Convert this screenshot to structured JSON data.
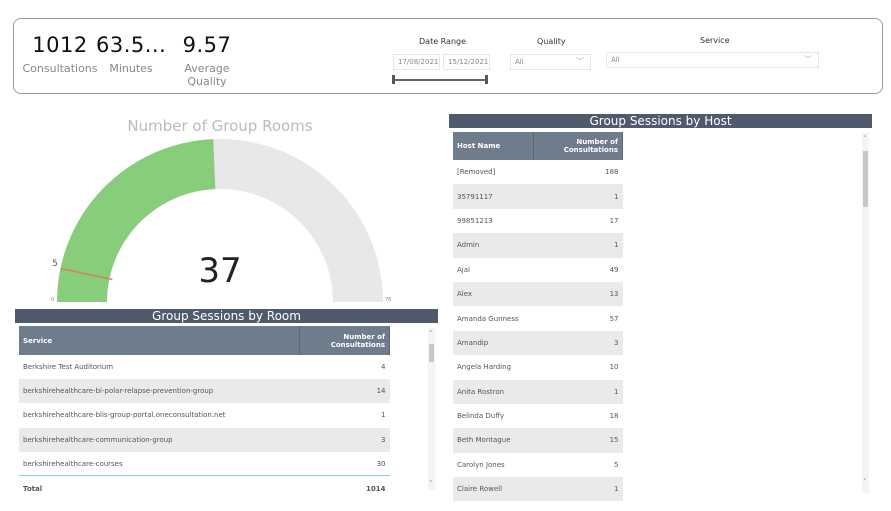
{
  "kpis": [
    {
      "value": "1012",
      "label": "Consultations"
    },
    {
      "value": "63.5...",
      "label": "Minutes"
    },
    {
      "value": "9.57",
      "label": "Average Quality"
    }
  ],
  "filters": {
    "date_range": {
      "label": "Date Range",
      "start": "17/08/2021",
      "end": "15/12/2021"
    },
    "quality": {
      "label": "Quality",
      "value": "All"
    },
    "service": {
      "label": "Service",
      "value": "All"
    }
  },
  "gauge": {
    "title": "Number of Group Rooms",
    "value": 37,
    "value_label": "37",
    "min": 0,
    "min_label": "0",
    "max": 76,
    "max_label": "76",
    "target": 5,
    "target_label": "5",
    "fill_color": "#87cd7c",
    "track_color": "#e8e8e8",
    "target_color": "#e07b5a"
  },
  "room_table": {
    "title": "Group Sessions by Room",
    "columns": [
      "Service",
      "Number of Consultations"
    ],
    "rows": [
      [
        "Berkshire Test Auditorium",
        "4"
      ],
      [
        "berkshirehealthcare-bi-polar-relapse-prevention-group",
        "14"
      ],
      [
        "berkshirehealthcare-blis-group-portal.oneconsultation.net",
        "1"
      ],
      [
        "berkshirehealthcare-communication-group",
        "3"
      ],
      [
        "berkshirehealthcare-courses",
        "30"
      ]
    ],
    "total_label": "Total",
    "total_value": "1014"
  },
  "host_table": {
    "title": "Group Sessions by Host",
    "columns": [
      "Host Name",
      "Number of Consultations"
    ],
    "rows": [
      [
        "[Removed]",
        "188"
      ],
      [
        "35791117",
        "1"
      ],
      [
        "99851213",
        "17"
      ],
      [
        "Admin",
        "1"
      ],
      [
        "Ajai",
        "49"
      ],
      [
        "Alex",
        "13"
      ],
      [
        "Amanda Gunness",
        "57"
      ],
      [
        "Amandip",
        "3"
      ],
      [
        "Angela Harding",
        "10"
      ],
      [
        "Anita Rostron",
        "1"
      ],
      [
        "Belinda Duffy",
        "18"
      ],
      [
        "Beth Montague",
        "15"
      ],
      [
        "Carolyn Jones",
        "5"
      ],
      [
        "Claire Rowell",
        "1"
      ]
    ]
  }
}
